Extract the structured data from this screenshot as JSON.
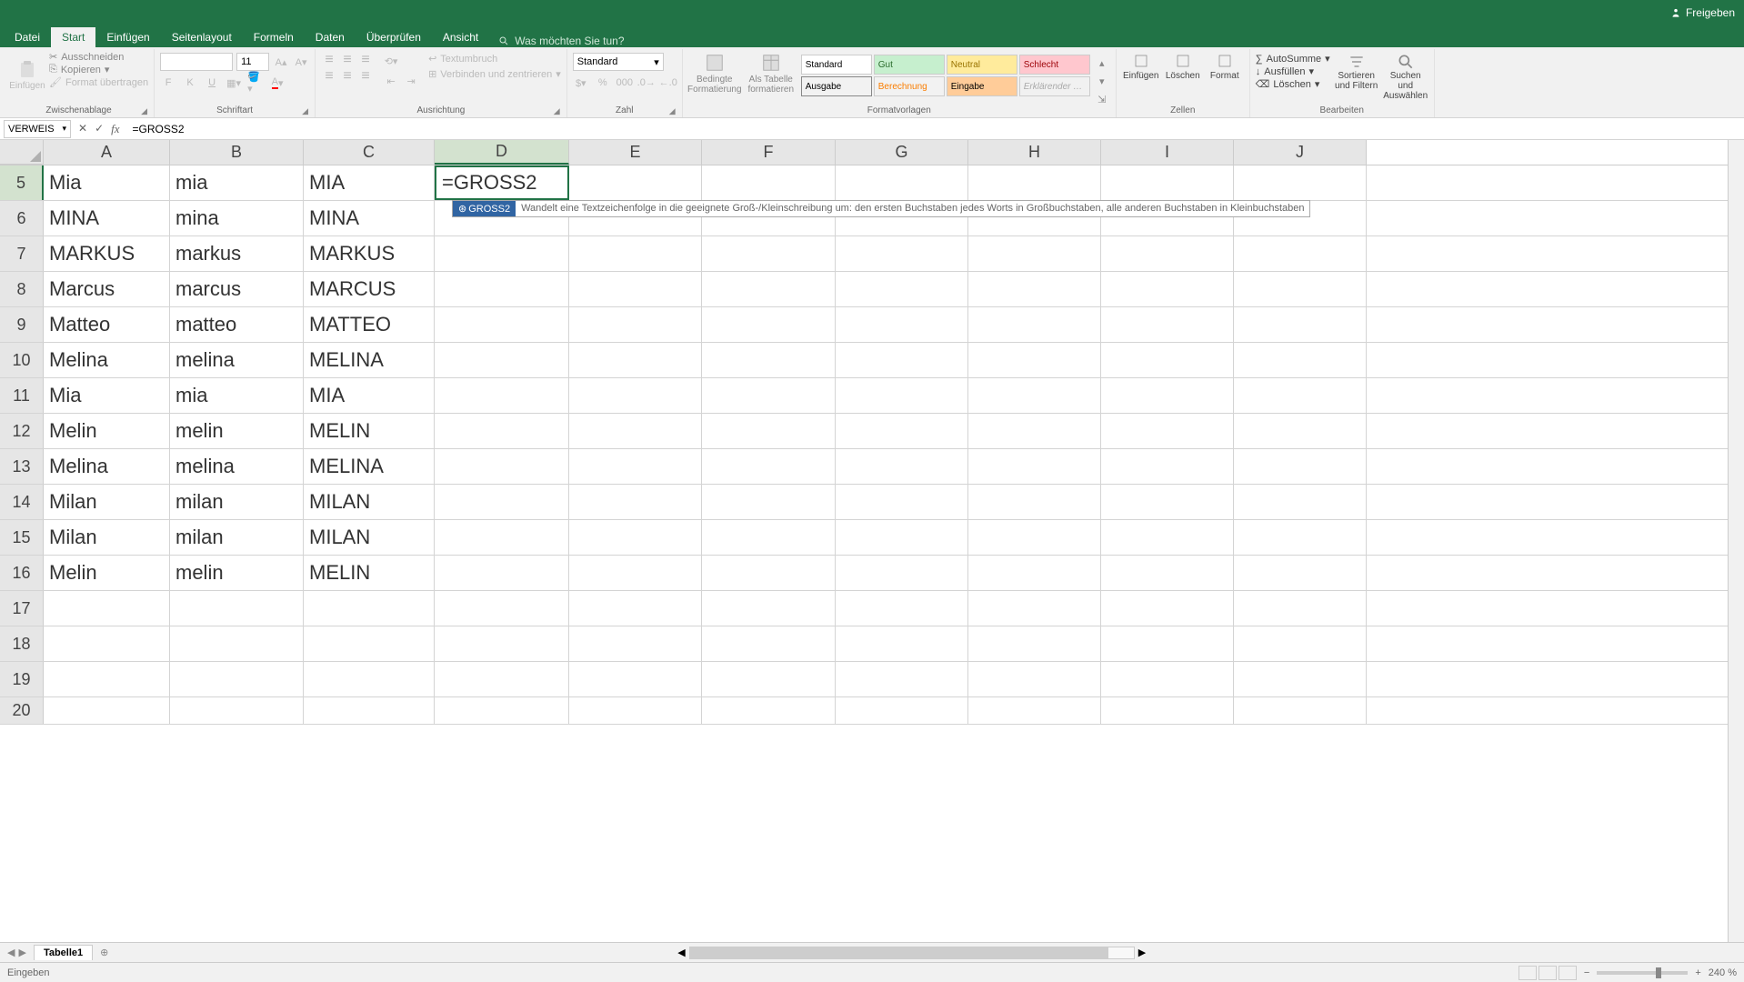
{
  "titlebar": {
    "share": "Freigeben"
  },
  "tabs": {
    "file": "Datei",
    "start": "Start",
    "einfuegen": "Einfügen",
    "seitenlayout": "Seitenlayout",
    "formeln": "Formeln",
    "daten": "Daten",
    "ueberpruefen": "Überprüfen",
    "ansicht": "Ansicht",
    "tellme": "Was möchten Sie tun?"
  },
  "ribbon": {
    "clipboard": {
      "paste": "Einfügen",
      "cut": "Ausschneiden",
      "copy": "Kopieren",
      "formatpainter": "Format übertragen",
      "label": "Zwischenablage"
    },
    "font": {
      "name": "",
      "size": "11",
      "b": "F",
      "i": "K",
      "u": "U",
      "label": "Schriftart"
    },
    "alignment": {
      "wrap": "Textumbruch",
      "merge": "Verbinden und zentrieren",
      "label": "Ausrichtung"
    },
    "number": {
      "format": "Standard",
      "label": "Zahl"
    },
    "styles": {
      "cond": "Bedingte Formatierung",
      "astable": "Als Tabelle formatieren",
      "label": "Formatvorlagen",
      "g": [
        "Standard",
        "Gut",
        "Neutral",
        "Schlecht",
        "Ausgabe",
        "Berechnung",
        "Eingabe",
        "Erklärender …"
      ]
    },
    "cells": {
      "insert": "Einfügen",
      "delete": "Löschen",
      "format": "Format",
      "label": "Zellen"
    },
    "editing": {
      "autosum": "AutoSumme",
      "fill": "Ausfüllen",
      "clear": "Löschen",
      "sort": "Sortieren und Filtern",
      "find": "Suchen und Auswählen",
      "label": "Bearbeiten"
    }
  },
  "fbar": {
    "namebox": "VERWEIS",
    "formula": "=GROSS2"
  },
  "columns": [
    "A",
    "B",
    "C",
    "D",
    "E",
    "F",
    "G",
    "H",
    "I",
    "J"
  ],
  "rows": [
    {
      "n": 5,
      "c": [
        "Mia",
        "mia",
        "MIA",
        "=GROSS2",
        "",
        "",
        "",
        "",
        "",
        ""
      ]
    },
    {
      "n": 6,
      "c": [
        "MINA",
        "mina",
        "MINA",
        "",
        "",
        "",
        "",
        "",
        "",
        ""
      ]
    },
    {
      "n": 7,
      "c": [
        "MARKUS",
        "markus",
        "MARKUS",
        "",
        "",
        "",
        "",
        "",
        "",
        ""
      ]
    },
    {
      "n": 8,
      "c": [
        "Marcus",
        "marcus",
        "MARCUS",
        "",
        "",
        "",
        "",
        "",
        "",
        ""
      ]
    },
    {
      "n": 9,
      "c": [
        "Matteo",
        "matteo",
        "MATTEO",
        "",
        "",
        "",
        "",
        "",
        "",
        ""
      ]
    },
    {
      "n": 10,
      "c": [
        "Melina",
        "melina",
        "MELINA",
        "",
        "",
        "",
        "",
        "",
        "",
        ""
      ]
    },
    {
      "n": 11,
      "c": [
        "Mia",
        "mia",
        "MIA",
        "",
        "",
        "",
        "",
        "",
        "",
        ""
      ]
    },
    {
      "n": 12,
      "c": [
        "Melin",
        "melin",
        "MELIN",
        "",
        "",
        "",
        "",
        "",
        "",
        ""
      ]
    },
    {
      "n": 13,
      "c": [
        "Melina",
        "melina",
        "MELINA",
        "",
        "",
        "",
        "",
        "",
        "",
        ""
      ]
    },
    {
      "n": 14,
      "c": [
        "Milan",
        "milan",
        "MILAN",
        "",
        "",
        "",
        "",
        "",
        "",
        ""
      ]
    },
    {
      "n": 15,
      "c": [
        "Milan",
        "milan",
        "MILAN",
        "",
        "",
        "",
        "",
        "",
        "",
        ""
      ]
    },
    {
      "n": 16,
      "c": [
        "Melin",
        "melin",
        "MELIN",
        "",
        "",
        "",
        "",
        "",
        "",
        ""
      ]
    },
    {
      "n": 17,
      "c": [
        "",
        "",
        "",
        "",
        "",
        "",
        "",
        "",
        "",
        ""
      ]
    },
    {
      "n": 18,
      "c": [
        "",
        "",
        "",
        "",
        "",
        "",
        "",
        "",
        "",
        ""
      ]
    },
    {
      "n": 19,
      "c": [
        "",
        "",
        "",
        "",
        "",
        "",
        "",
        "",
        "",
        ""
      ]
    },
    {
      "n": 20,
      "c": [
        "",
        "",
        "",
        "",
        "",
        "",
        "",
        "",
        "",
        ""
      ]
    }
  ],
  "tooltip": {
    "fn": "GROSS2",
    "desc": "Wandelt eine Textzeichenfolge in die geeignete Groß-/Kleinschreibung um: den ersten Buchstaben jedes Worts in Großbuchstaben, alle anderen Buchstaben in Kleinbuchstaben"
  },
  "sheets": {
    "tab": "Tabelle1"
  },
  "status": {
    "mode": "Eingeben",
    "zoom": "240 %"
  },
  "activeCell": {
    "row": 5,
    "col": 3
  }
}
